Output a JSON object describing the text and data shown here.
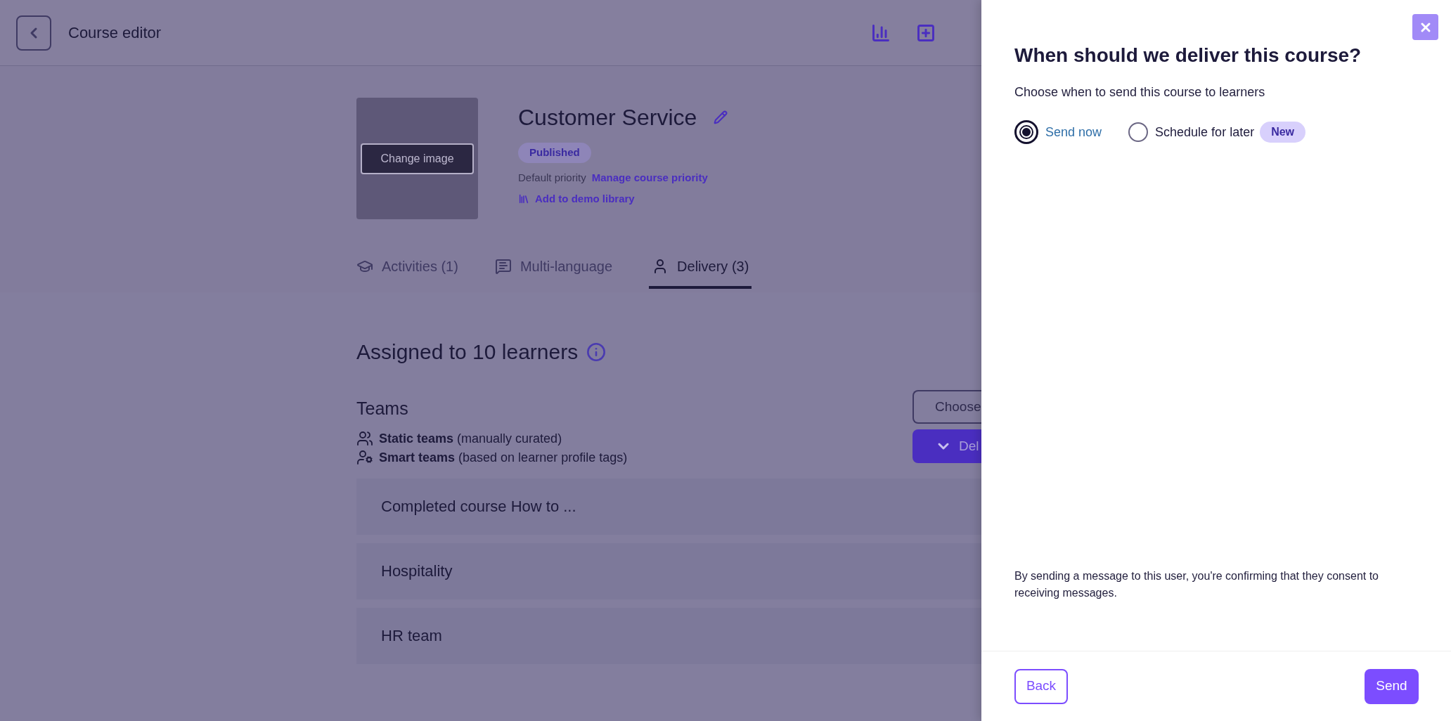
{
  "header": {
    "title": "Course editor"
  },
  "course": {
    "image_button": "Change image",
    "title": "Customer Service",
    "status": "Published",
    "priority_label": "Default priority",
    "priority_link": "Manage course priority",
    "demo_link": "Add to demo library"
  },
  "tabs": [
    {
      "label": "Activities (1)",
      "selected": false
    },
    {
      "label": "Multi-language",
      "selected": false
    },
    {
      "label": "Delivery (3)",
      "selected": true
    }
  ],
  "delivery": {
    "heading": "Assigned to 10 learners",
    "teams_heading": "Teams",
    "legend": [
      "**Static teams** (manually curated)",
      "**Smart teams** (based on learner profile tags)"
    ],
    "choose_button": "Choose",
    "deliver_button": "Del",
    "rows": [
      "Completed course How to ...",
      "Hospitality",
      "HR team"
    ]
  },
  "panel": {
    "title": "When should we deliver this course?",
    "subtitle": "Choose when to send this course to learners",
    "options": [
      {
        "label": "Send now",
        "selected": true
      },
      {
        "label": "Schedule for later",
        "selected": false,
        "badge": "New"
      }
    ],
    "consent": "By sending a message to this user, you're confirming that they consent to receiving messages.",
    "back_button": "Back",
    "send_button": "Send"
  }
}
